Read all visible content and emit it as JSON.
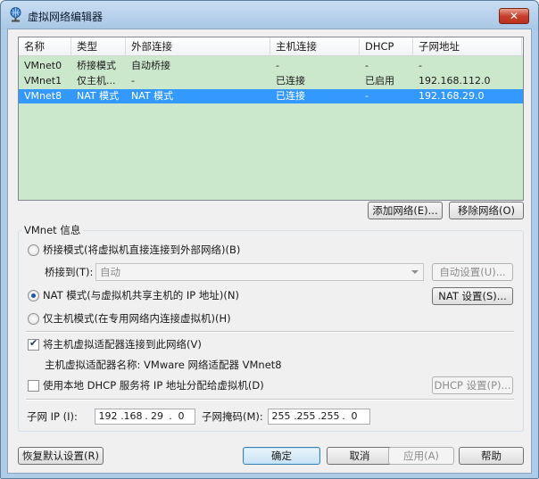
{
  "window": {
    "title": "虚拟网络编辑器",
    "close": "✕"
  },
  "columns": [
    "名称",
    "类型",
    "外部连接",
    "主机连接",
    "DHCP",
    "子网地址"
  ],
  "networks": [
    {
      "name": "VMnet0",
      "type": "桥接模式",
      "external": "自动桥接",
      "host": "-",
      "dhcp": "-",
      "subnet": "-"
    },
    {
      "name": "VMnet1",
      "type": "仅主机...",
      "external": "-",
      "host": "已连接",
      "dhcp": "已启用",
      "subnet": "192.168.112.0"
    },
    {
      "name": "VMnet8",
      "type": "NAT 模式",
      "external": "NAT 模式",
      "host": "已连接",
      "dhcp": "-",
      "subnet": "192.168.29.0"
    }
  ],
  "list_buttons": {
    "add": "添加网络(E)...",
    "remove": "移除网络(O)"
  },
  "vmnet_info": {
    "title": "VMnet 信息",
    "bridged_label": "桥接模式(将虚拟机直接连接到外部网络)(B)",
    "bridge_to_label": "桥接到(T):",
    "bridge_to_value": "自动",
    "auto_settings": "自动设置(U)...",
    "nat_label": "NAT 模式(与虚拟机共享主机的 IP 地址)(N)",
    "nat_settings": "NAT 设置(S)...",
    "hostonly_label": "仅主机模式(在专用网络内连接虚拟机)(H)",
    "connect_adapter_label": "将主机虚拟适配器连接到此网络(V)",
    "adapter_name": "主机虚拟适配器名称: VMware 网络适配器 VMnet8",
    "dhcp_label": "使用本地 DHCP 服务将 IP 地址分配给虚拟机(D)",
    "dhcp_settings": "DHCP 设置(P)...",
    "subnet_ip_label": "子网 IP (I):",
    "subnet_ip": [
      "192",
      "168",
      "29",
      "0"
    ],
    "subnet_mask_label": "子网掩码(M):",
    "subnet_mask": [
      "255",
      "255",
      "255",
      "0"
    ],
    "selected_mode": "nat",
    "connect_adapter_checked": true,
    "dhcp_checked": false
  },
  "footer": {
    "restore": "恢复默认设置(R)",
    "ok": "确定",
    "cancel": "取消",
    "apply": "应用(A)",
    "help": "帮助"
  },
  "colors": {
    "list_bg": "#cce8cc",
    "selection": "#3399ff",
    "titlebar": "#aecbe8"
  }
}
